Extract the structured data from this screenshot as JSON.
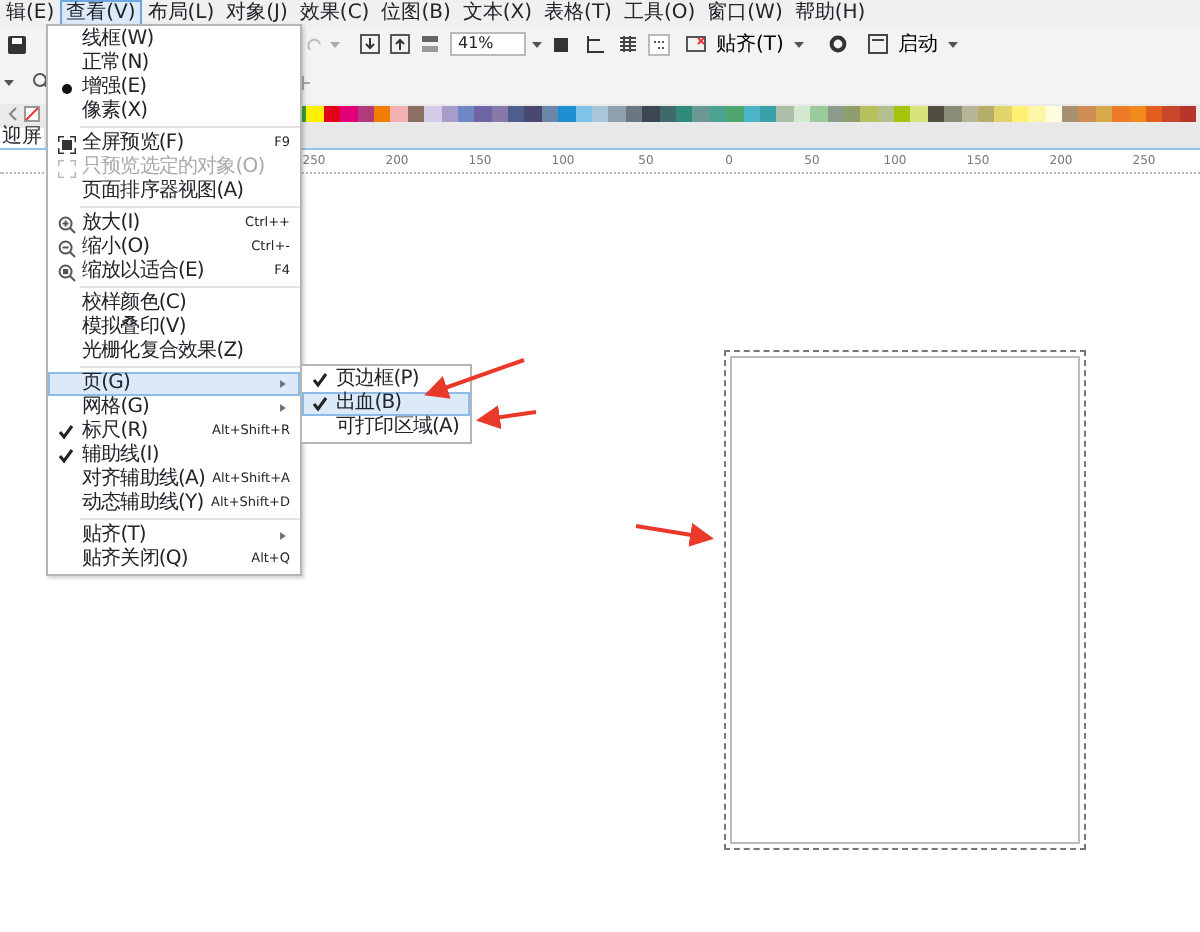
{
  "menubar": [
    {
      "label": "辑(E)",
      "selected": false
    },
    {
      "label": "查看(V)",
      "selected": true
    },
    {
      "label": "布局(L)",
      "selected": false
    },
    {
      "label": "对象(J)",
      "selected": false
    },
    {
      "label": "效果(C)",
      "selected": false
    },
    {
      "label": "位图(B)",
      "selected": false
    },
    {
      "label": "文本(X)",
      "selected": false
    },
    {
      "label": "表格(T)",
      "selected": false
    },
    {
      "label": "工具(O)",
      "selected": false
    },
    {
      "label": "窗口(W)",
      "selected": false
    },
    {
      "label": "帮助(H)",
      "selected": false
    }
  ],
  "toolbar": {
    "zoom": "41%",
    "snap": "贴齐(T)",
    "launch": "启动"
  },
  "palette": [
    {
      "color": "#3aa335"
    },
    {
      "color": "#ffef00"
    },
    {
      "color": "#e4001b"
    },
    {
      "color": "#e2007a"
    },
    {
      "color": "#b03a7c"
    },
    {
      "color": "#ef7d00"
    },
    {
      "color": "#f3b0b0"
    },
    {
      "color": "#8b6f63"
    },
    {
      "color": "#d4cce6"
    },
    {
      "color": "#a79ccb"
    },
    {
      "color": "#7186c4"
    },
    {
      "color": "#6f64a5"
    },
    {
      "color": "#8979a8"
    },
    {
      "color": "#4f5d8c"
    },
    {
      "color": "#4a4870"
    },
    {
      "color": "#6b86a6"
    },
    {
      "color": "#1e8fd0"
    },
    {
      "color": "#7fc4e8"
    },
    {
      "color": "#a9c6d8"
    },
    {
      "color": "#8fa1ad"
    },
    {
      "color": "#6b7783"
    },
    {
      "color": "#3e4651"
    },
    {
      "color": "#3e6b6a"
    },
    {
      "color": "#2f8a7a"
    },
    {
      "color": "#6a9893"
    },
    {
      "color": "#4aa393"
    },
    {
      "color": "#4fa56e"
    },
    {
      "color": "#4cb4c8"
    },
    {
      "color": "#3aa1a8"
    },
    {
      "color": "#aebfa9"
    },
    {
      "color": "#d2e8cf"
    },
    {
      "color": "#99cc9a"
    },
    {
      "color": "#8c9c8c"
    },
    {
      "color": "#8f9e6c"
    },
    {
      "color": "#b6c05c"
    },
    {
      "color": "#b1c28e"
    },
    {
      "color": "#a6c40b"
    },
    {
      "color": "#d7e37c"
    },
    {
      "color": "#4f4d3e"
    },
    {
      "color": "#8a8c76"
    },
    {
      "color": "#b8b49a"
    },
    {
      "color": "#b5ad6a"
    },
    {
      "color": "#e2d46a"
    },
    {
      "color": "#fff173"
    },
    {
      "color": "#fff6a8"
    },
    {
      "color": "#fffde0"
    },
    {
      "color": "#a89070"
    },
    {
      "color": "#cf8e55"
    },
    {
      "color": "#d8a94a"
    },
    {
      "color": "#ee7b28"
    },
    {
      "color": "#f08a1c"
    },
    {
      "color": "#e35d1e"
    },
    {
      "color": "#c8462a"
    },
    {
      "color": "#b8352c"
    }
  ],
  "document_tab": "迎屏",
  "ruler_labels": [
    "250",
    "200",
    "150",
    "100",
    "50",
    "0",
    "50",
    "100",
    "150",
    "200",
    "250"
  ],
  "view_menu": [
    {
      "kind": "radio",
      "label": "线框(W)",
      "selected": false,
      "highlighted": false
    },
    {
      "kind": "radio",
      "label": "正常(N)",
      "selected": false,
      "highlighted": false
    },
    {
      "kind": "radio",
      "label": "增强(E)",
      "selected": true,
      "highlighted": false
    },
    {
      "kind": "radio",
      "label": "像素(X)",
      "selected": false,
      "highlighted": false
    },
    {
      "kind": "separator"
    },
    {
      "kind": "fullscreen",
      "label": "全屏预览(F)",
      "shortcut": "F9",
      "disabled": false,
      "highlighted": false
    },
    {
      "kind": "fullscreen",
      "label": "只预览选定的对象(O)",
      "disabled": true,
      "highlighted": false
    },
    {
      "kind": "command",
      "label": "页面排序器视图(A)",
      "highlighted": false
    },
    {
      "kind": "separator"
    },
    {
      "kind": "zoomin",
      "label": "放大(I)",
      "shortcut": "Ctrl++",
      "highlighted": false
    },
    {
      "kind": "zoomout",
      "label": "缩小(O)",
      "shortcut": "Ctrl+-",
      "highlighted": false
    },
    {
      "kind": "zoomfit",
      "label": "缩放以适合(E)",
      "shortcut": "F4",
      "highlighted": false
    },
    {
      "kind": "separator"
    },
    {
      "kind": "command",
      "label": "校样颜色(C)",
      "highlighted": false
    },
    {
      "kind": "command",
      "label": "模拟叠印(V)",
      "highlighted": false
    },
    {
      "kind": "command",
      "label": "光栅化复合效果(Z)",
      "highlighted": false
    },
    {
      "kind": "separator"
    },
    {
      "kind": "submenu",
      "label": "页(G)",
      "highlighted": true
    },
    {
      "kind": "submenu",
      "label": "网格(G)",
      "highlighted": false
    },
    {
      "kind": "check",
      "label": "标尺(R)",
      "shortcut": "Alt+Shift+R",
      "checked": true,
      "highlighted": false
    },
    {
      "kind": "check",
      "label": "辅助线(I)",
      "checked": true,
      "highlighted": false
    },
    {
      "kind": "check",
      "label": "对齐辅助线(A)",
      "shortcut": "Alt+Shift+A",
      "checked": false,
      "highlighted": false
    },
    {
      "kind": "check",
      "label": "动态辅助线(Y)",
      "shortcut": "Alt+Shift+D",
      "checked": false,
      "highlighted": false
    },
    {
      "kind": "separator"
    },
    {
      "kind": "submenu",
      "label": "贴齐(T)",
      "highlighted": false
    },
    {
      "kind": "command",
      "label": "贴齐关闭(Q)",
      "shortcut": "Alt+Q",
      "highlighted": false
    }
  ],
  "page_submenu": [
    {
      "label": "页边框(P)",
      "checked": true,
      "highlighted": false
    },
    {
      "label": "出血(B)",
      "checked": true,
      "highlighted": true
    },
    {
      "label": "可打印区域(A)",
      "checked": false,
      "highlighted": false
    }
  ]
}
